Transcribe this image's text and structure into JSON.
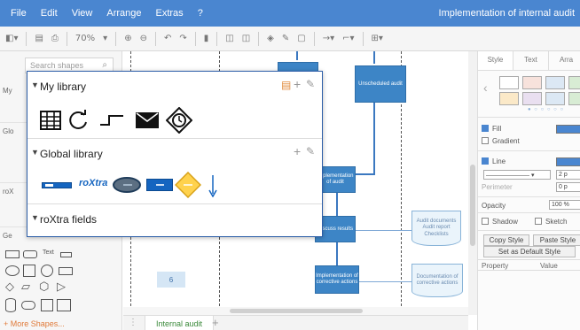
{
  "menubar": {
    "items": [
      "File",
      "Edit",
      "View",
      "Arrange",
      "Extras",
      "?"
    ],
    "title": "Implementation of internal audit"
  },
  "toolbar": {
    "zoom": "70%"
  },
  "sidebar": {
    "search_placeholder": "Search shapes",
    "section_fragments": [
      "My",
      "Glo",
      "roX",
      "Ge"
    ],
    "shape_text_label": "Text",
    "more_shapes": "+ More Shapes..."
  },
  "canvas": {
    "shapes": {
      "unscheduled_audit": "Unscheduled audit",
      "implementation_audit": "Implementation of audit",
      "discuss_results": "Discuss results",
      "implementation_corrective": "Implementation of corrective actions",
      "audit_documents": "Audit documents Audit report Checklists",
      "documentation_corrective": "Documentation of corrective actions"
    },
    "row_number": "6"
  },
  "pages": {
    "tab": "Internal audit",
    "add_label": "+"
  },
  "format_panel": {
    "tabs": [
      "Style",
      "Text",
      "Arra"
    ],
    "fill": "Fill",
    "gradient": "Gradient",
    "line": "Line",
    "line_width": "2 p",
    "perimeter": "Perimeter",
    "perimeter_value": "0 p",
    "opacity": "Opacity",
    "opacity_value": "100 %",
    "shadow": "Shadow",
    "sketch": "Sketch",
    "copy_style": "Copy Style",
    "paste_style": "Paste Style",
    "set_default": "Set as Default Style",
    "property": "Property",
    "value": "Value",
    "swatch_colors": [
      "#ffffff",
      "#f7e2dc",
      "#dce8f4",
      "#d8ecd4",
      "#fbe9c8",
      "#e9dff0"
    ],
    "accent": "#4a86d0"
  },
  "popup": {
    "my_library": "My library",
    "global_library": "Global library",
    "roxtra_fields": "roXtra fields",
    "roxtra_logo": "roXtra",
    "icons": [
      "table-icon",
      "rotate-icon",
      "connector-icon",
      "envelope-icon",
      "timer-event-icon"
    ]
  }
}
